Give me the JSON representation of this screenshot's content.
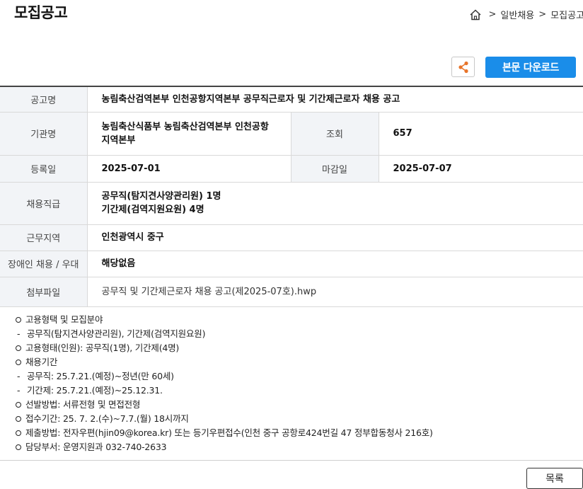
{
  "header": {
    "title": "모집공고",
    "breadcrumb": [
      "일반채용",
      "모집공고"
    ],
    "breadcrumb_sep": ">"
  },
  "toolbar": {
    "share_icon": "share-icon",
    "download_label": "본문 다운로드"
  },
  "info": {
    "title_label": "공고명",
    "title_value": "농림축산검역본부 인천공항지역본부 공무직근로자 및 기간제근로자 채용 공고",
    "org_label": "기관명",
    "org_value_line1": "농림축산식품부 농림축산검역본부 인천공항",
    "org_value_line2": "지역본부",
    "views_label": "조회",
    "views_value": "657",
    "reg_label": "등록일",
    "reg_value": "2025-07-01",
    "deadline_label": "마감일",
    "deadline_value": "2025-07-07",
    "rank_label": "채용직급",
    "rank_value_line1": "공무직(탐지견사양관리원) 1명",
    "rank_value_line2": "기간제(검역지원요원) 4명",
    "region_label": "근무지역",
    "region_value": "인천광역시 중구",
    "disabled_label": "장애인 채용 / 우대",
    "disabled_value": "해당없음",
    "attach_label": "첨부파일",
    "attach_value": "공무직 및 기간제근로자 채용 공고(제2025-07호).hwp"
  },
  "body": {
    "l1": "고용형택 및 모집분야",
    "l2": "공무직(탐지견사양관리원), 기간제(검역지원요원)",
    "l3": "고용형태(인원):  공무직(1명), 기간제(4명)",
    "l4": "채용기간",
    "l5": " 공무직: 25.7.21.(예정)~정년(만 60세)",
    "l6": " 기간제: 25.7.21.(예정)~25.12.31.",
    "l7": "선발방법: 서류전형 및 면접전형",
    "l8": "접수기간:  25. 7. 2.(수)~7.7.(월) 18시까지",
    "l9": "제출방법: 전자우편(hjin09@korea.kr) 또는 등기우편접수(인천 중구 공항로424번길 47 정부합동청사 216호)",
    "l10": "담당부서: 운영지원과 032-740-2633"
  },
  "footer": {
    "list_label": "목록"
  },
  "colors": {
    "accent": "#1a8de9",
    "share_icon": "#e8742a",
    "th_bg": "#f2f4f7"
  }
}
